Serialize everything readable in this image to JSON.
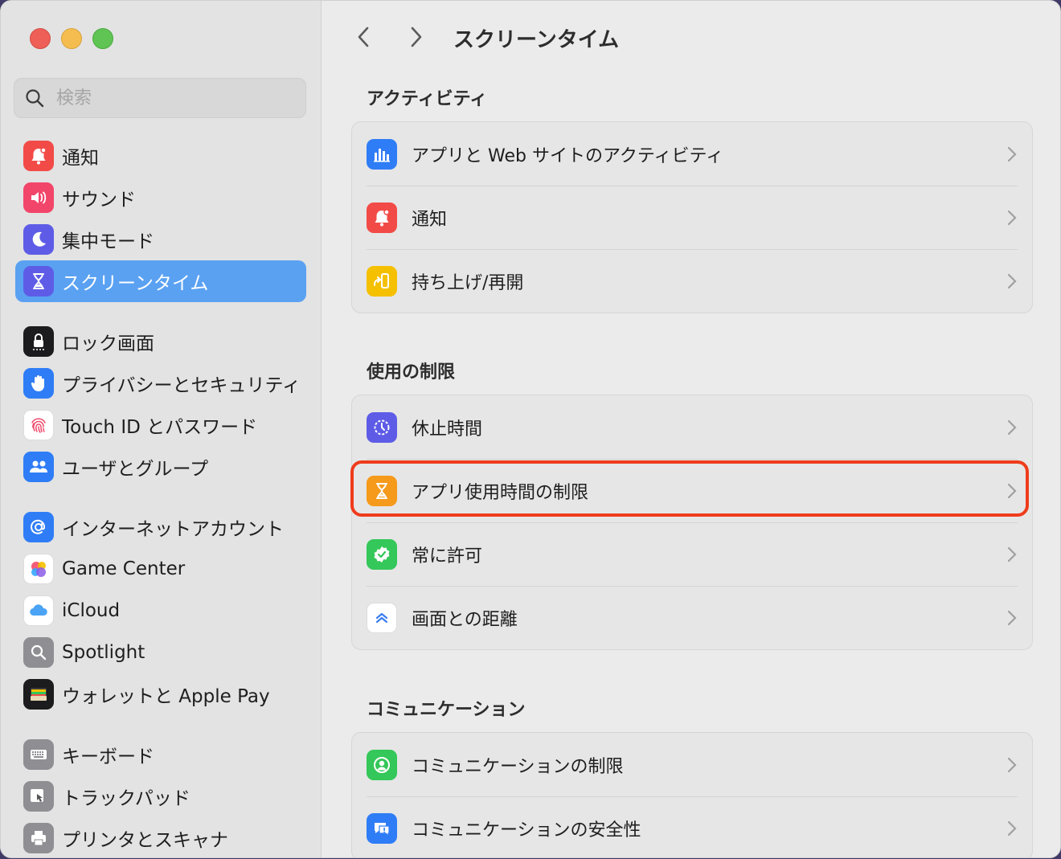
{
  "search": {
    "placeholder": "検索"
  },
  "sidebar": {
    "groups": [
      [
        {
          "label": "通知",
          "icon": "bell-icon",
          "color": "#f24b47"
        },
        {
          "label": "サウンド",
          "icon": "speaker-icon",
          "color": "#f2456a"
        },
        {
          "label": "集中モード",
          "icon": "moon-icon",
          "color": "#5e5ce6"
        },
        {
          "label": "スクリーンタイム",
          "icon": "hourglass-icon",
          "color": "#5e5ce6",
          "selected": true
        }
      ],
      [
        {
          "label": "ロック画面",
          "icon": "lock-icon",
          "color": "#1c1c1e"
        },
        {
          "label": "プライバシーとセキュリティ",
          "icon": "hand-icon",
          "color": "#2f7df6"
        },
        {
          "label": "Touch ID とパスワード",
          "icon": "fingerprint-icon",
          "color": "#ffffff"
        },
        {
          "label": "ユーザとグループ",
          "icon": "users-icon",
          "color": "#2f7df6"
        }
      ],
      [
        {
          "label": "インターネットアカウント",
          "icon": "at-icon",
          "color": "#2f7df6"
        },
        {
          "label": "Game Center",
          "icon": "game-center-icon",
          "color": "#ffffff"
        },
        {
          "label": "iCloud",
          "icon": "cloud-icon",
          "color": "#ffffff"
        },
        {
          "label": "Spotlight",
          "icon": "magnifier-icon",
          "color": "#8e8e93"
        },
        {
          "label": "ウォレットと Apple Pay",
          "icon": "wallet-icon",
          "color": "#1c1c1e"
        }
      ],
      [
        {
          "label": "キーボード",
          "icon": "keyboard-icon",
          "color": "#8e8e93"
        },
        {
          "label": "トラックパッド",
          "icon": "trackpad-icon",
          "color": "#8e8e93"
        },
        {
          "label": "プリンタとスキャナ",
          "icon": "printer-icon",
          "color": "#8e8e93"
        }
      ]
    ]
  },
  "header": {
    "title": "スクリーンタイム"
  },
  "sections": [
    {
      "title": "アクティビティ",
      "rows": [
        {
          "label": "アプリと Web サイトのアクティビティ",
          "icon": "bar-chart-icon",
          "color": "#2f7df6"
        },
        {
          "label": "通知",
          "icon": "bell-icon",
          "color": "#f24b47"
        },
        {
          "label": "持ち上げ/再開",
          "icon": "pickup-icon",
          "color": "#f5c000"
        }
      ]
    },
    {
      "title": "使用の制限",
      "rows": [
        {
          "label": "休止時間",
          "icon": "downtime-icon",
          "color": "#5e5ce6"
        },
        {
          "label": "アプリ使用時間の制限",
          "icon": "hourglass-icon",
          "color": "#f59a1b",
          "highlighted": true
        },
        {
          "label": "常に許可",
          "icon": "checkmark-badge-icon",
          "color": "#34c759"
        },
        {
          "label": "画面との距離",
          "icon": "chevrons-up-icon",
          "color": "#ffffff"
        }
      ]
    },
    {
      "title": "コミュニケーション",
      "rows": [
        {
          "label": "コミュニケーションの制限",
          "icon": "person-circle-icon",
          "color": "#34c759"
        },
        {
          "label": "コミュニケーションの安全性",
          "icon": "message-alert-icon",
          "color": "#2f7df6"
        }
      ]
    }
  ]
}
